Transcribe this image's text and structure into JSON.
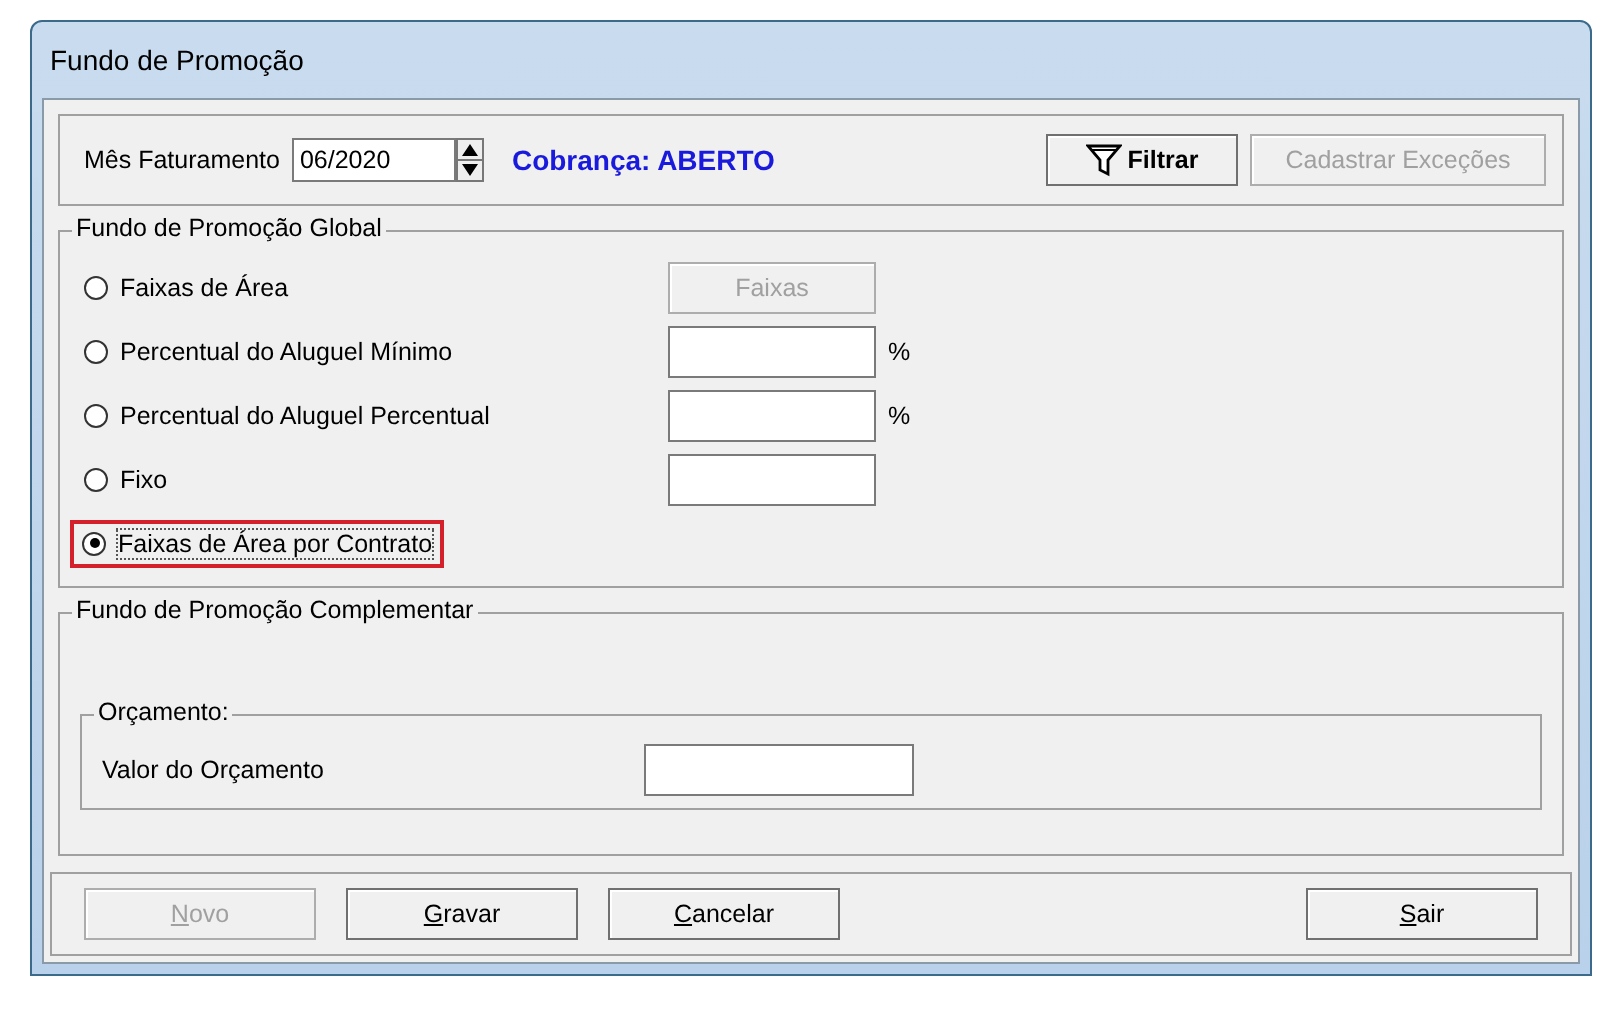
{
  "window": {
    "title": "Fundo de Promoção"
  },
  "header": {
    "month_label": "Mês Faturamento",
    "month_value": "06/2020",
    "status": "Cobrança: ABERTO",
    "filter_button": "Filtrar",
    "exceptions_button": {
      "label": "Cadastrar Exceções",
      "disabled": true
    }
  },
  "global": {
    "title": "Fundo de Promoção Global",
    "options": [
      {
        "label": "Faixas de Área",
        "selected": false,
        "highlighted": false,
        "kind": "button",
        "button": {
          "label": "Faixas",
          "disabled": true
        }
      },
      {
        "label": "Percentual do Aluguel Mínimo",
        "selected": false,
        "highlighted": false,
        "kind": "percent",
        "unit": "%"
      },
      {
        "label": "Percentual do Aluguel Percentual",
        "selected": false,
        "highlighted": false,
        "kind": "percent",
        "unit": "%"
      },
      {
        "label": "Fixo",
        "selected": false,
        "highlighted": false,
        "kind": "input"
      },
      {
        "label": "Faixas de Área por Contrato",
        "selected": true,
        "highlighted": true,
        "kind": "none"
      }
    ]
  },
  "complementar": {
    "title": "Fundo de Promoção Complementar",
    "budget": {
      "title": "Orçamento:",
      "label": "Valor do Orçamento"
    }
  },
  "left_buttons": [
    {
      "label": "Novo",
      "disabled": true
    },
    {
      "label": "Gravar",
      "disabled": false
    },
    {
      "label": "Cancelar",
      "disabled": false
    }
  ],
  "right_buttons": [
    {
      "label": "Sair",
      "disabled": false
    }
  ]
}
